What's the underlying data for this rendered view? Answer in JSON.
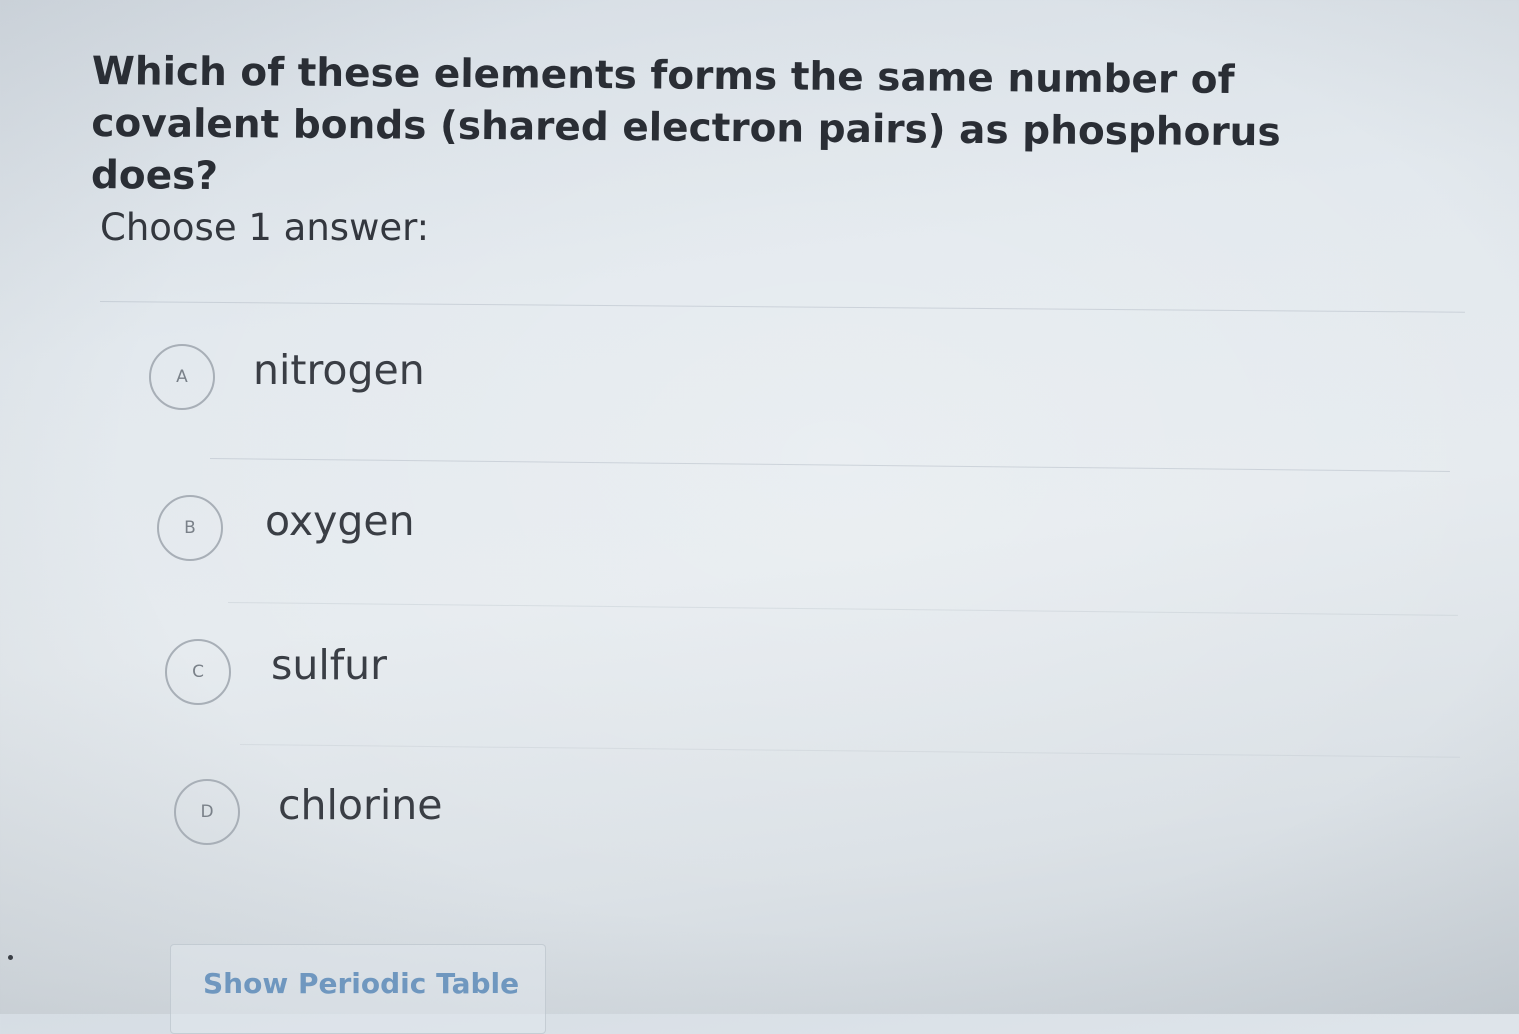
{
  "question": {
    "text": "Which of these elements forms the same number of covalent bonds (shared electron pairs) as phosphorus does?"
  },
  "instruction": "Choose 1 answer:",
  "choices": [
    {
      "letter": "A",
      "label": "nitrogen"
    },
    {
      "letter": "B",
      "label": "oxygen"
    },
    {
      "letter": "C",
      "label": "sulfur"
    },
    {
      "letter": "D",
      "label": "chlorine"
    }
  ],
  "periodic_table_button": "Show Periodic Table",
  "colors": {
    "background": "#e3e9ee",
    "text": "#2a2e35",
    "link": "#6f97bf",
    "circle_border": "#a8afb7"
  }
}
